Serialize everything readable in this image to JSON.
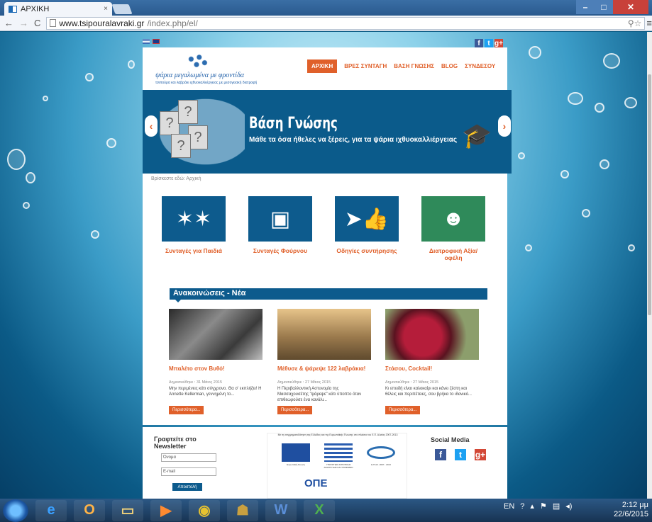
{
  "browser": {
    "tab_title": "ΑΡΧΙΚΗ",
    "tab_close": "×",
    "url_domain": "www.tsipouralavraki.gr",
    "url_path": "/index.php/el/"
  },
  "site": {
    "logo_title": "ψάρια μεγαλωμένα με φροντίδα",
    "logo_subtitle": "τσιπούρα και λαβράκι ιχθυοκαλλιέργειας με μεσογειακή διατροφή",
    "menu": [
      {
        "label": "ΑΡΧΙΚΗ",
        "active": true
      },
      {
        "label": "ΒΡΕΣ ΣΥΝΤΑΓΗ"
      },
      {
        "label": "ΒΑΣΗ ΓΝΩΣΗΣ"
      },
      {
        "label": "BLOG"
      },
      {
        "label": "ΣΥΝΔΕΣΟΥ"
      }
    ],
    "banner": {
      "title": "Βάση Γνώσης",
      "subtitle": "Μάθε τα όσα ήθελες να ξέρεις, για τα ψάρια ιχθυοκαλλιέργειας"
    },
    "breadcrumb": "Βρίσκεστε εδώ:  Αρχική",
    "categories": [
      {
        "label": "Συνταγές για Παιδιά"
      },
      {
        "label": "Συνταγές Φούρνου"
      },
      {
        "label": "Οδηγίες συντήρησης"
      },
      {
        "label": "Διατροφική Αξία/ οφέλη"
      }
    ],
    "news_heading": "Ανακοινώσεις - Νέα",
    "articles": [
      {
        "title": "Μπαλέτο στον Βυθό!",
        "date": "Δημοσιεύθηκε : 31 Μάιος 2015",
        "text": "Μην περιμένεις κάτι σύγχρονο. Θα σ' εκπλήξει! Η Annette Kellerman, γεννημένη το...",
        "more": "Περισσότερα..."
      },
      {
        "title": "Μέθυσε & ψάρεψε 122 λαβράκια!",
        "date": "Δημοσιεύθηκε : 27 Μάιος 2015",
        "text": "Η Περιβαλλοντική Αστυνομία της Μασσαχουσέτης \"ψάρεψε\" κάτι ύποπτο όταν επιθεωρούσε ένα κανάλι...",
        "more": "Περισσότερα..."
      },
      {
        "title": "Στάσου, Cocktail!",
        "date": "Δημοσιεύθηκε : 27 Μάιος 2015",
        "text": "Κι επειδή είναι καλοκαίρι και κάνει ζέστη και θέλεις και περιπέτειες, σου βρήκα το ιδανικό...",
        "more": "Περισσότερα..."
      }
    ],
    "newsletter": {
      "title": "Γραφτείτε στο Newsletter",
      "name_placeholder": "Όνομα",
      "email_placeholder": "E-mail",
      "submit": "Αποστολή"
    },
    "partners_caption": "Με τη συγχρηματοδότηση της Ελλάδας και της Ευρωπαϊκής Ένωσης στο πλαίσιο του Ε.Π. Αλιείας 2007-2013",
    "partners": [
      "Ευρωπαϊκή Ένωση",
      "ΥΠΟΥΡΓΕΙΟ ΑΓΡΟΤΙΚΗΣ ΑΝΑΠΤΥΞΗΣ ΚΑΙ ΤΡΟΦΙΜΩΝ",
      "Ε.Π.ΑΛ. 2007 - 2013"
    ],
    "ope_logo": "ΟΠΕ",
    "social_media_title": "Social Media",
    "social": [
      "f",
      "t",
      "g+"
    ]
  },
  "taskbar": {
    "lang": "EN",
    "time": "2:12 μμ",
    "date": "22/6/2015"
  },
  "colors": {
    "accent_orange": "#e0602a",
    "brand_blue": "#0d5b8d"
  }
}
